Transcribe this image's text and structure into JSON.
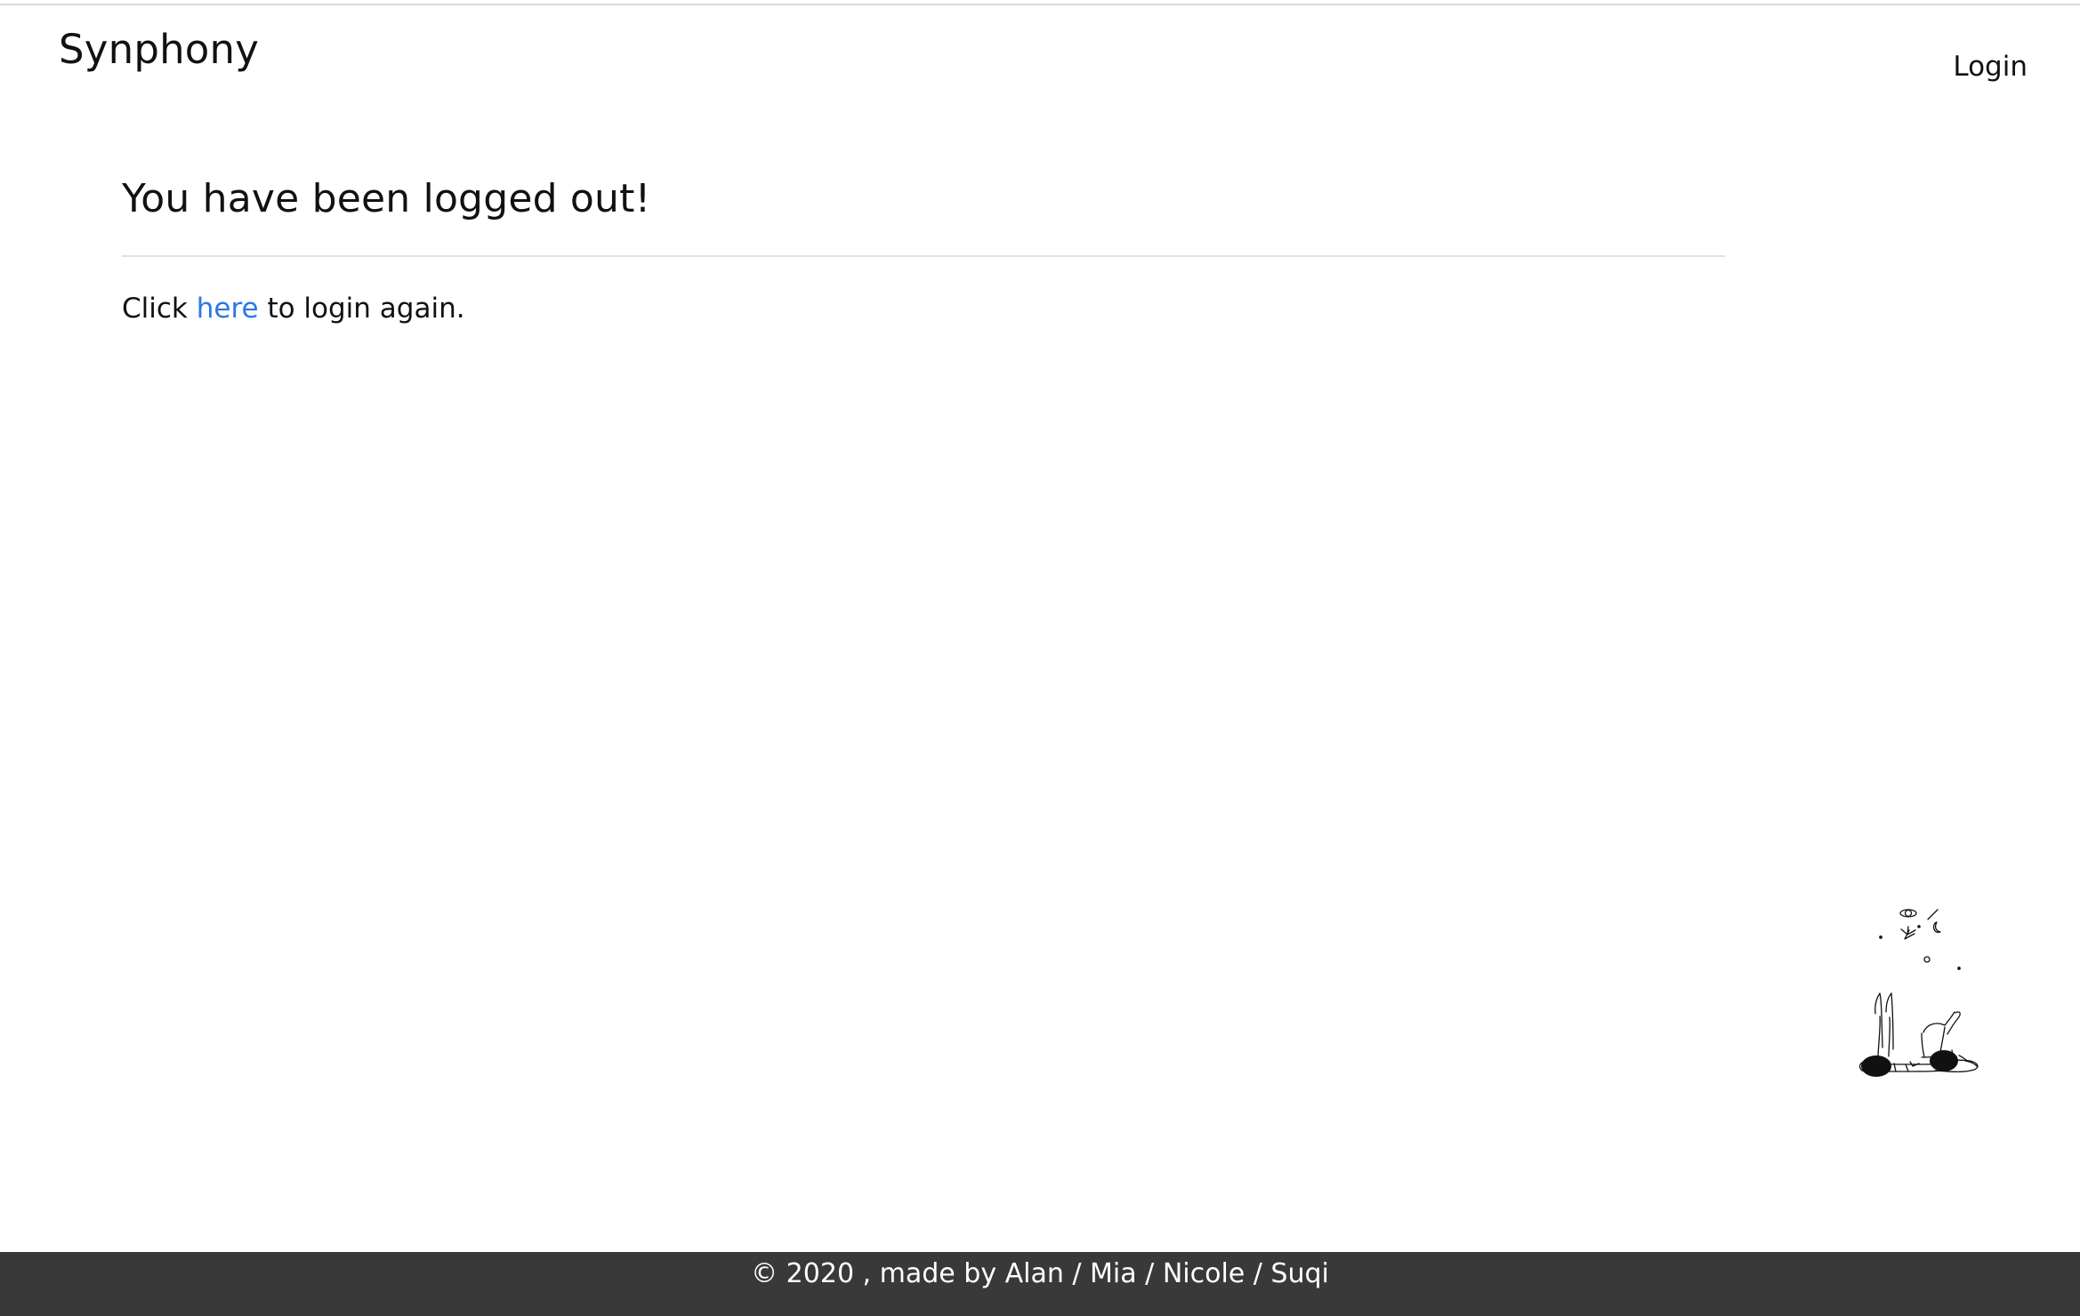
{
  "header": {
    "brand": "Synphony",
    "login_label": "Login"
  },
  "main": {
    "heading": "You have been logged out!",
    "message_prefix": "Click",
    "login_link_label": "here",
    "message_suffix": "to login again."
  },
  "illustration": {
    "icon": "stargazing-people-illustration"
  },
  "footer": {
    "copyright": "© 2020 , made by Alan / Mia / Nicole / Suqi"
  },
  "colors": {
    "link": "#2a78e4",
    "footer_background": "#393939",
    "footer_text": "#ffffff",
    "divider": "#e1e1e1"
  }
}
